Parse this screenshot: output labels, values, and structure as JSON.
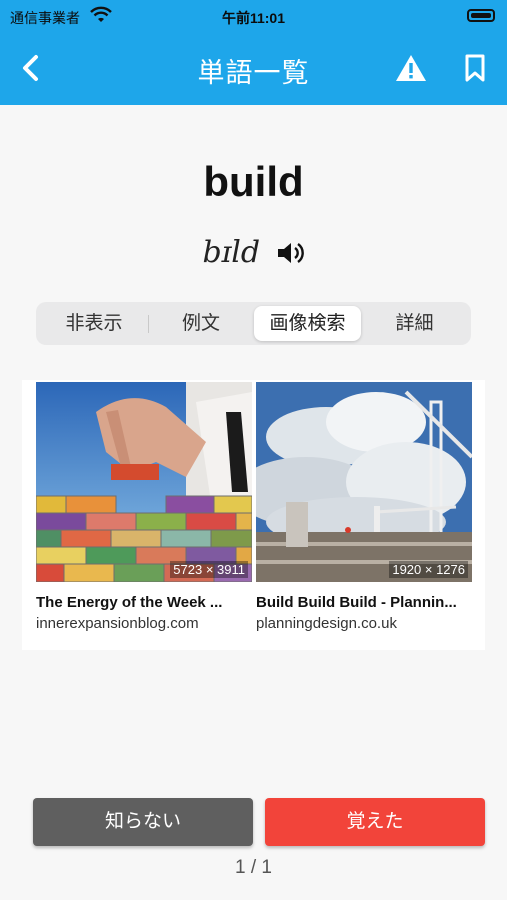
{
  "status_bar": {
    "carrier": "通信事業者",
    "time": "午前11:01"
  },
  "nav": {
    "title": "単語一覧",
    "back_icon": "chevron-left-icon",
    "warning_icon": "warning-icon",
    "bookmark_icon": "bookmark-icon"
  },
  "word": "build",
  "pronunciation": "bɪld",
  "tabs": [
    {
      "label": "非表示",
      "active": false
    },
    {
      "label": "例文",
      "active": false
    },
    {
      "label": "画像検索",
      "active": true
    },
    {
      "label": "詳細",
      "active": false
    }
  ],
  "images": [
    {
      "title": "The Energy of the Week ...",
      "source": "innerexpansionblog.com",
      "dimensions": "5723 × 3911"
    },
    {
      "title": "Build Build Build - Plannin...",
      "source": "planningdesign.co.uk",
      "dimensions": "1920 × 1276"
    }
  ],
  "buttons": {
    "dont_know": "知らない",
    "learned": "覚えた"
  },
  "pager": "1 / 1",
  "colors": {
    "accent": "#1ea6ea",
    "learned": "#f2443a",
    "dont_know": "#5f5f5f"
  }
}
